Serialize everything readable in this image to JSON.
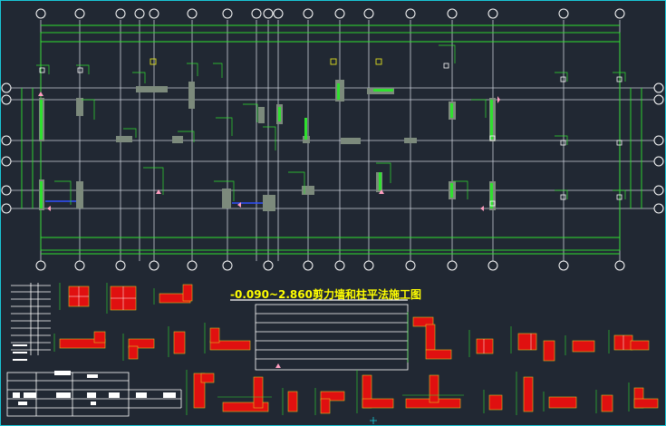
{
  "drawing": {
    "title": "-0.090~2.860剪力墙和柱平法施工图"
  },
  "colors": {
    "background": "#212833",
    "axis_lines": "#c9ced8",
    "dimension_lines": "#2fe02f",
    "wall_fill": "#7c8a7c",
    "wall_highlight": "#2fe02f",
    "rebar_red": "#e01010",
    "outline_yellow": "#e0c020",
    "title_text": "#ffff00",
    "frame_cyan": "#19c8d8",
    "blue_line": "#3050ff"
  },
  "icons": {
    "grid_bubble": "circle-icon",
    "frame_marker": "triangle-icon"
  }
}
